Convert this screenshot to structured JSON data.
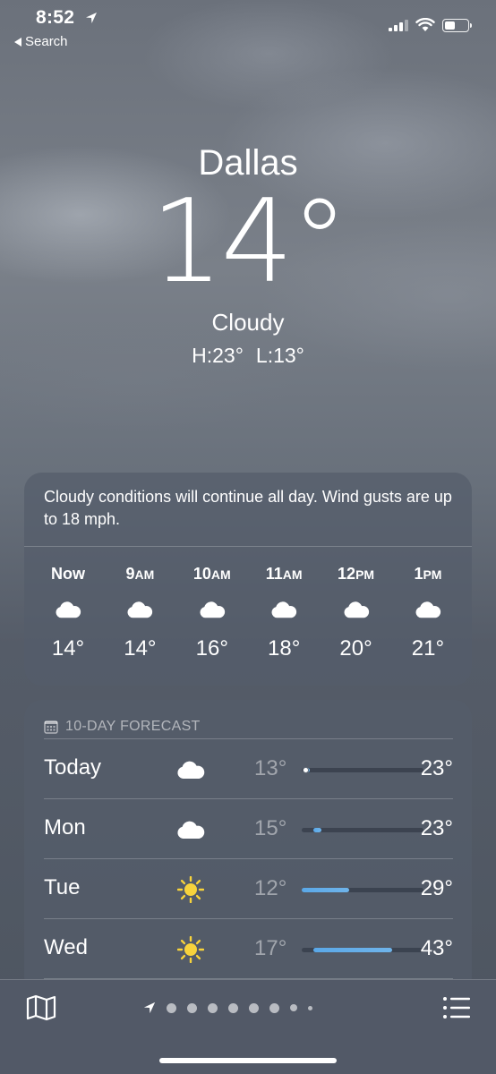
{
  "status_bar": {
    "time": "8:52",
    "back_label": "Search"
  },
  "header": {
    "city": "Dallas",
    "temperature": "14°",
    "condition": "Cloudy",
    "high": "H:23°",
    "low": "L:13°"
  },
  "hourly": {
    "summary": "Cloudy conditions will continue all day. Wind gusts are up to 18 mph.",
    "items": [
      {
        "label": "Now",
        "suffix": "",
        "icon": "cloud-icon",
        "temp": "14°"
      },
      {
        "label": "9",
        "suffix": "AM",
        "icon": "cloud-icon",
        "temp": "14°"
      },
      {
        "label": "10",
        "suffix": "AM",
        "icon": "cloud-icon",
        "temp": "16°"
      },
      {
        "label": "11",
        "suffix": "AM",
        "icon": "cloud-icon",
        "temp": "18°"
      },
      {
        "label": "12",
        "suffix": "PM",
        "icon": "cloud-icon",
        "temp": "20°"
      },
      {
        "label": "1",
        "suffix": "PM",
        "icon": "cloud-icon",
        "temp": "21°"
      }
    ]
  },
  "forecast": {
    "title": "10-DAY FORECAST",
    "range_min": 12,
    "range_max": 43,
    "days": [
      {
        "day": "Today",
        "icon": "cloud-icon",
        "low": "13°",
        "high": "23°",
        "low_value": 13,
        "high_value": 14,
        "current_value": 14
      },
      {
        "day": "Mon",
        "icon": "cloud-icon",
        "low": "15°",
        "high": "23°",
        "low_value": 15,
        "high_value": 17
      },
      {
        "day": "Tue",
        "icon": "sun-icon",
        "low": "12°",
        "high": "29°",
        "low_value": 12,
        "high_value": 24
      },
      {
        "day": "Wed",
        "icon": "sun-icon",
        "low": "17°",
        "high": "43°",
        "low_value": 15,
        "high_value": 35
      }
    ]
  },
  "colors": {
    "bar_fill": "#5aa8e8",
    "card_bg": "#545d6b",
    "sun": "#f7d33c"
  },
  "toolbar": {
    "map_icon": "map-icon",
    "location_icon": "location-arrow-icon",
    "page_count": 9,
    "list_icon": "list-icon"
  }
}
